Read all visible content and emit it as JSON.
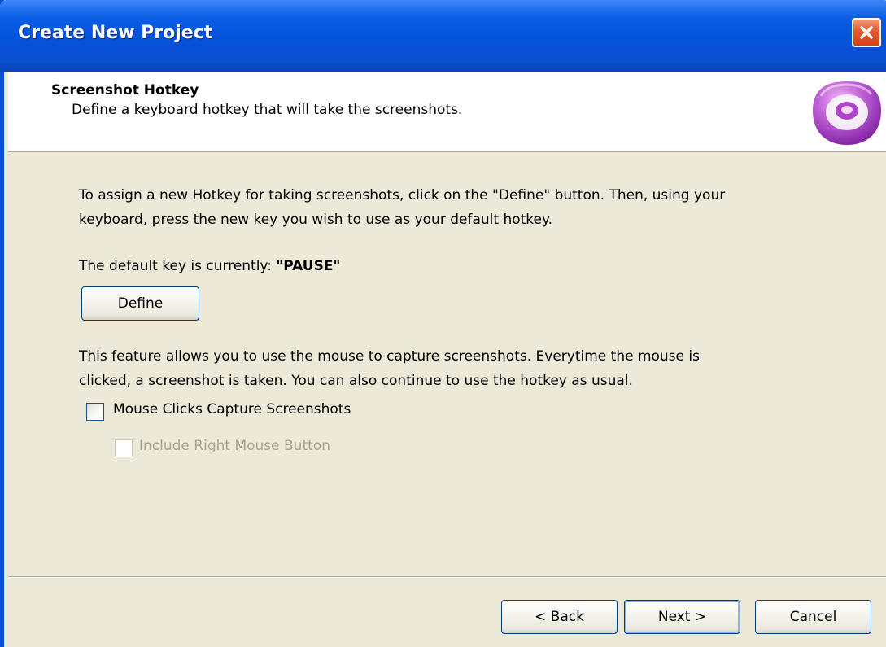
{
  "window": {
    "title": "Create New Project"
  },
  "header": {
    "title": "Screenshot Hotkey",
    "subtitle": "Define a keyboard hotkey that will take the screenshots."
  },
  "content": {
    "intro_line1": "To assign a new Hotkey for taking screenshots, click on the \"Define\" button. Then, using your",
    "intro_line2": "keyboard, press the new key you wish to use as your default hotkey.",
    "default_key_prefix": "The default key is currently: ",
    "default_key_value": "\"PAUSE\"",
    "define_button": "Define",
    "mouse_line1": "This feature allows you to use the mouse to capture screenshots. Everytime the mouse is",
    "mouse_line2": "clicked, a screenshot is taken. You can also continue to use the hotkey as usual.",
    "mouse_clicks_checkbox": {
      "label": "Mouse Clicks Capture Screenshots",
      "checked": false
    },
    "right_button_checkbox": {
      "label": "Include Right Mouse Button",
      "checked": false,
      "enabled": false
    }
  },
  "footer": {
    "back_button": "< Back",
    "next_button": "Next >",
    "cancel_button": "Cancel"
  },
  "icons": {
    "close": "close-icon",
    "logo": "app-logo-icon"
  },
  "colors": {
    "titlebar": "#0a5de6",
    "dialog_background": "#ece9d8",
    "close_button": "#e2592e",
    "logo_purple": "#a43fc4",
    "disabled_text": "#a6a293"
  }
}
